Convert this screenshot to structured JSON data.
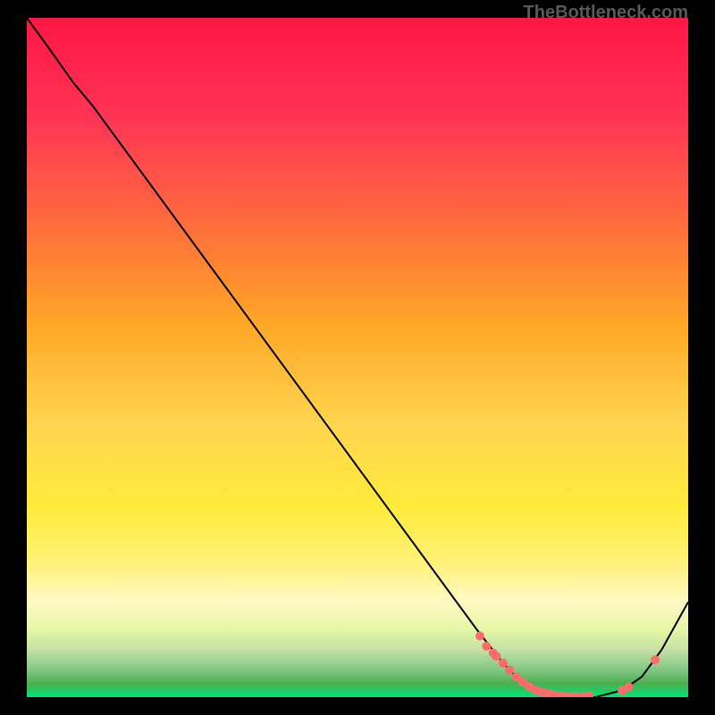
{
  "watermark": "TheBottleneck.com",
  "chart_data": {
    "type": "line",
    "title": "",
    "xlabel": "",
    "ylabel": "",
    "xlim": [
      0,
      100
    ],
    "ylim": [
      0,
      100
    ],
    "gradient_stops": [
      {
        "offset": 0,
        "color": "#ff1744"
      },
      {
        "offset": 15,
        "color": "#ff3555"
      },
      {
        "offset": 30,
        "color": "#ff6b3d"
      },
      {
        "offset": 45,
        "color": "#ffa726"
      },
      {
        "offset": 60,
        "color": "#ffd54f"
      },
      {
        "offset": 72,
        "color": "#ffeb3b"
      },
      {
        "offset": 80,
        "color": "#fff176"
      },
      {
        "offset": 86,
        "color": "#fff9c4"
      },
      {
        "offset": 90,
        "color": "#e6f7a6"
      },
      {
        "offset": 93,
        "color": "#c5e1a5"
      },
      {
        "offset": 96,
        "color": "#81c784"
      },
      {
        "offset": 98,
        "color": "#4caf50"
      },
      {
        "offset": 100,
        "color": "#00e676"
      }
    ],
    "curve_points": [
      {
        "x": 0,
        "y": 100
      },
      {
        "x": 3,
        "y": 96
      },
      {
        "x": 7,
        "y": 90.5
      },
      {
        "x": 10,
        "y": 87
      },
      {
        "x": 68,
        "y": 10
      },
      {
        "x": 72,
        "y": 5
      },
      {
        "x": 75,
        "y": 2
      },
      {
        "x": 78,
        "y": 0.5
      },
      {
        "x": 82,
        "y": 0
      },
      {
        "x": 86,
        "y": 0
      },
      {
        "x": 90,
        "y": 1
      },
      {
        "x": 93,
        "y": 3
      },
      {
        "x": 96,
        "y": 7
      },
      {
        "x": 100,
        "y": 14
      }
    ],
    "marker_points": [
      {
        "x": 68.5,
        "y": 9
      },
      {
        "x": 69.5,
        "y": 7.5
      },
      {
        "x": 70.5,
        "y": 6.5
      },
      {
        "x": 71,
        "y": 6
      },
      {
        "x": 72,
        "y": 5
      },
      {
        "x": 73,
        "y": 4
      },
      {
        "x": 74,
        "y": 3
      },
      {
        "x": 75,
        "y": 2.2
      },
      {
        "x": 76,
        "y": 1.5
      },
      {
        "x": 77,
        "y": 1
      },
      {
        "x": 78,
        "y": 0.7
      },
      {
        "x": 79,
        "y": 0.5
      },
      {
        "x": 80,
        "y": 0.3
      },
      {
        "x": 81,
        "y": 0.2
      },
      {
        "x": 82,
        "y": 0.1
      },
      {
        "x": 83,
        "y": 0.1
      },
      {
        "x": 84,
        "y": 0.1
      },
      {
        "x": 85,
        "y": 0.2
      },
      {
        "x": 90,
        "y": 1
      },
      {
        "x": 91,
        "y": 1.5
      },
      {
        "x": 95,
        "y": 5.5
      }
    ],
    "marker_color": "#ff6b6b"
  }
}
